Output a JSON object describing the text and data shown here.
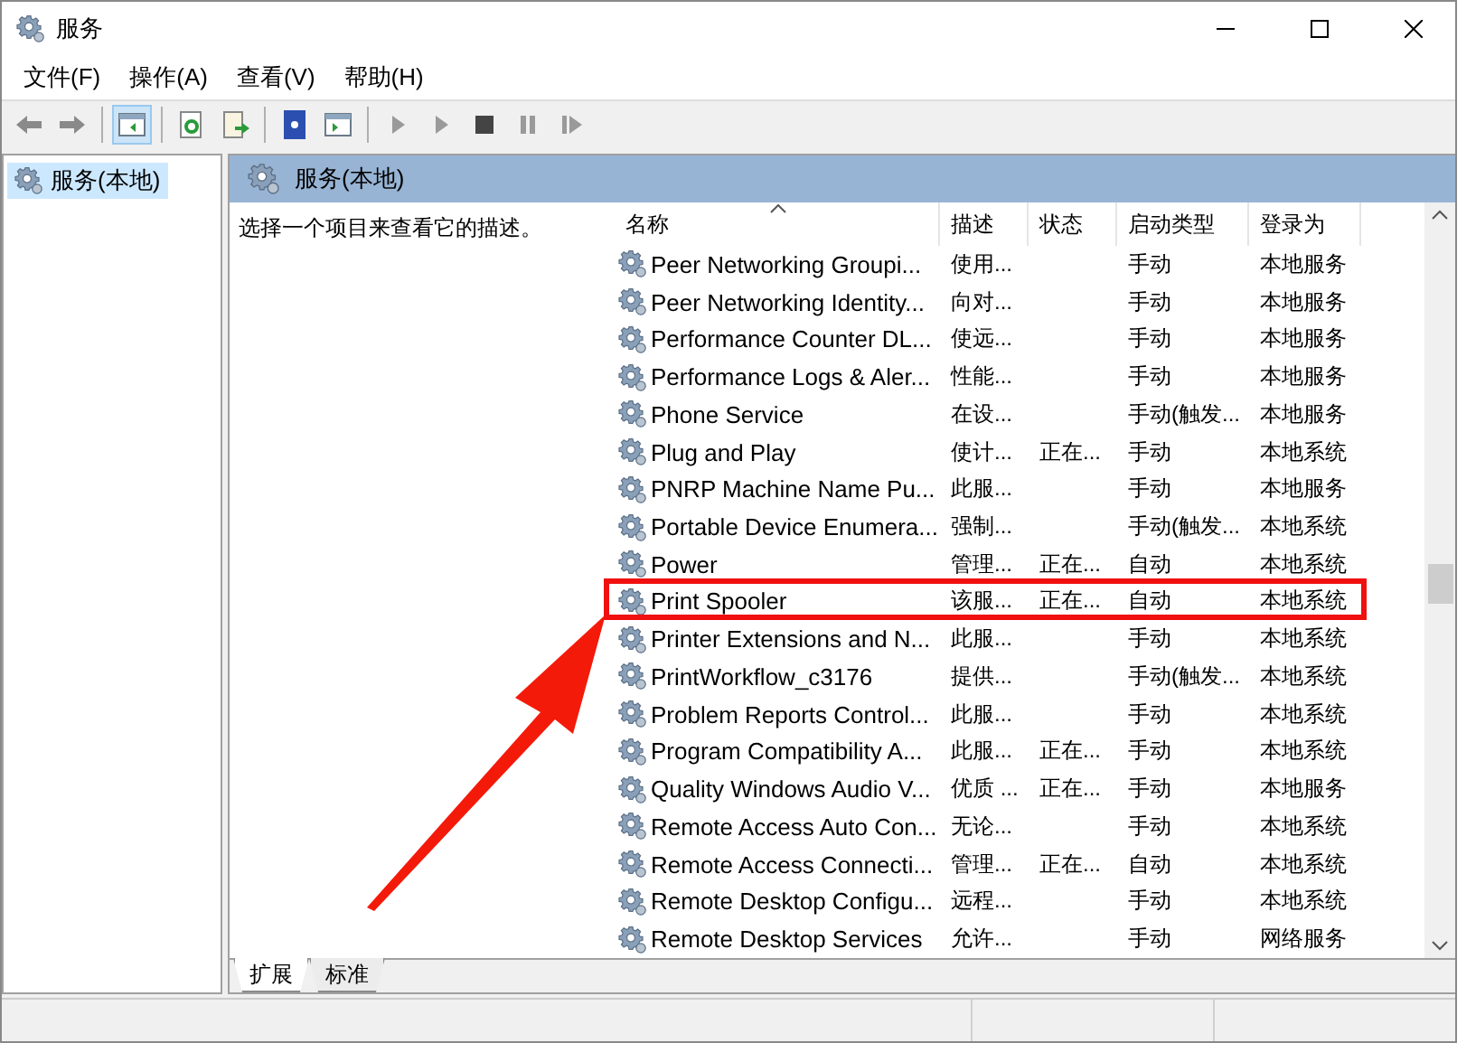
{
  "window": {
    "title": "服务"
  },
  "menu": [
    "文件(F)",
    "操作(A)",
    "查看(V)",
    "帮助(H)"
  ],
  "toolbar": [
    {
      "kind": "back",
      "pressed": false
    },
    {
      "kind": "forward",
      "pressed": false
    },
    {
      "kind": "separator"
    },
    {
      "kind": "tree",
      "pressed": true
    },
    {
      "kind": "separator"
    },
    {
      "kind": "refresh",
      "pressed": false
    },
    {
      "kind": "export",
      "pressed": false
    },
    {
      "kind": "separator"
    },
    {
      "kind": "help",
      "pressed": false
    },
    {
      "kind": "panel",
      "pressed": false
    },
    {
      "kind": "separator"
    },
    {
      "kind": "play",
      "pressed": false
    },
    {
      "kind": "play",
      "pressed": false
    },
    {
      "kind": "stop",
      "pressed": false
    },
    {
      "kind": "pause",
      "pressed": false
    },
    {
      "kind": "resume",
      "pressed": false
    }
  ],
  "tree": {
    "items": [
      {
        "label": "服务(本地)",
        "selected": true
      }
    ]
  },
  "pane": {
    "title": "服务(本地)",
    "description": "选择一个项目来查看它的描述。"
  },
  "services": {
    "columns": [
      {
        "label": "名称",
        "sorted": true
      },
      {
        "label": "描述",
        "sorted": false
      },
      {
        "label": "状态",
        "sorted": false
      },
      {
        "label": "启动类型",
        "sorted": false
      },
      {
        "label": "登录为",
        "sorted": false
      }
    ],
    "rows": [
      {
        "name": "Peer Networking Groupi...",
        "description": "使用...",
        "status": "",
        "startup_type": "手动",
        "logon_as": "本地服务",
        "highlighted": false
      },
      {
        "name": "Peer Networking Identity...",
        "description": "向对...",
        "status": "",
        "startup_type": "手动",
        "logon_as": "本地服务",
        "highlighted": false
      },
      {
        "name": "Performance Counter DL...",
        "description": "使远...",
        "status": "",
        "startup_type": "手动",
        "logon_as": "本地服务",
        "highlighted": false
      },
      {
        "name": "Performance Logs & Aler...",
        "description": "性能...",
        "status": "",
        "startup_type": "手动",
        "logon_as": "本地服务",
        "highlighted": false
      },
      {
        "name": "Phone Service",
        "description": "在设...",
        "status": "",
        "startup_type": "手动(触发...",
        "logon_as": "本地服务",
        "highlighted": false
      },
      {
        "name": "Plug and Play",
        "description": "使计...",
        "status": "正在...",
        "startup_type": "手动",
        "logon_as": "本地系统",
        "highlighted": false
      },
      {
        "name": "PNRP Machine Name Pu...",
        "description": "此服...",
        "status": "",
        "startup_type": "手动",
        "logon_as": "本地服务",
        "highlighted": false
      },
      {
        "name": "Portable Device Enumera...",
        "description": "强制...",
        "status": "",
        "startup_type": "手动(触发...",
        "logon_as": "本地系统",
        "highlighted": false
      },
      {
        "name": "Power",
        "description": "管理...",
        "status": "正在...",
        "startup_type": "自动",
        "logon_as": "本地系统",
        "highlighted": false
      },
      {
        "name": "Print Spooler",
        "description": "该服...",
        "status": "正在...",
        "startup_type": "自动",
        "logon_as": "本地系统",
        "highlighted": true
      },
      {
        "name": "Printer Extensions and N...",
        "description": "此服...",
        "status": "",
        "startup_type": "手动",
        "logon_as": "本地系统",
        "highlighted": false
      },
      {
        "name": "PrintWorkflow_c3176",
        "description": "提供...",
        "status": "",
        "startup_type": "手动(触发...",
        "logon_as": "本地系统",
        "highlighted": false
      },
      {
        "name": "Problem Reports Control...",
        "description": "此服...",
        "status": "",
        "startup_type": "手动",
        "logon_as": "本地系统",
        "highlighted": false
      },
      {
        "name": "Program Compatibility A...",
        "description": "此服...",
        "status": "正在...",
        "startup_type": "手动",
        "logon_as": "本地系统",
        "highlighted": false
      },
      {
        "name": "Quality Windows Audio V...",
        "description": "优质 ...",
        "status": "正在...",
        "startup_type": "手动",
        "logon_as": "本地服务",
        "highlighted": false
      },
      {
        "name": "Remote Access Auto Con...",
        "description": "无论...",
        "status": "",
        "startup_type": "手动",
        "logon_as": "本地系统",
        "highlighted": false
      },
      {
        "name": "Remote Access Connecti...",
        "description": "管理...",
        "status": "正在...",
        "startup_type": "自动",
        "logon_as": "本地系统",
        "highlighted": false
      },
      {
        "name": "Remote Desktop Configu...",
        "description": "远程...",
        "status": "",
        "startup_type": "手动",
        "logon_as": "本地系统",
        "highlighted": false
      },
      {
        "name": "Remote Desktop Services",
        "description": "允许...",
        "status": "",
        "startup_type": "手动",
        "logon_as": "网络服务",
        "highlighted": false
      }
    ]
  },
  "bottom_tabs": [
    {
      "label": "扩展",
      "selected": true
    },
    {
      "label": "标准",
      "selected": false
    }
  ]
}
